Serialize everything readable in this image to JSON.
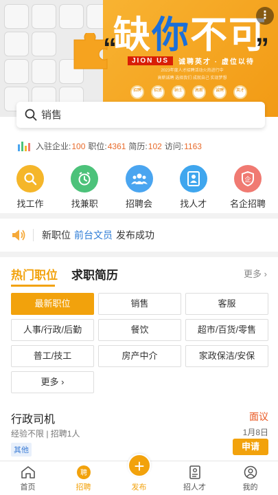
{
  "banner": {
    "title_left": "缺",
    "title_mid": "你",
    "title_right": "不可",
    "jion_tag": "JION US",
    "slogan": "诚聘英才 · 虚位以待",
    "line1": "2023年度人才招聘活动火热进行中",
    "line2": "高薪诚聘  选择我们  成就自己  实现梦想",
    "circles": [
      "招聘",
      "招贤",
      "纳士",
      "高薪",
      "诚聘",
      "英才"
    ],
    "more_icon": "more-dots-icon"
  },
  "search": {
    "placeholder": "销售"
  },
  "stats": {
    "companies_label": "入驻企业:",
    "companies": "100",
    "jobs_label": "职位:",
    "jobs": "4361",
    "resumes_label": "简历:",
    "resumes": "102",
    "visits_label": "访问:",
    "visits": "1163"
  },
  "quick": [
    {
      "label": "找工作",
      "icon": "search-icon",
      "color": "#f5b62a"
    },
    {
      "label": "找兼职",
      "icon": "clock-icon",
      "color": "#4cc27a"
    },
    {
      "label": "招聘会",
      "icon": "group-icon",
      "color": "#4aa5f0"
    },
    {
      "label": "找人才",
      "icon": "person-card-icon",
      "color": "#3fa6ee"
    },
    {
      "label": "名企招聘",
      "icon": "shield-icon",
      "color": "#f07a72"
    }
  ],
  "notice": {
    "prefix": "新职位",
    "job": "前台文员",
    "suffix": "发布成功",
    "icon": "speaker-icon"
  },
  "tabs": {
    "hot": "热门职位",
    "resume": "求职简历",
    "more": "更多 ›"
  },
  "categories": [
    "最新职位",
    "销售",
    "客服",
    "人事/行政/后勤",
    "餐饮",
    "超市/百货/零售",
    "普工/技工",
    "房产中介",
    "家政保洁/安保",
    "更多 ›"
  ],
  "job": {
    "title": "行政司机",
    "salary": "面议",
    "meta": "经验不限 | 招聘1人",
    "date": "1月8日",
    "tag": "其他",
    "apply": "申请"
  },
  "nav": {
    "home": "首页",
    "recruit": "招聘",
    "publish": "发布",
    "talent": "招人才",
    "mine": "我的"
  },
  "colors": {
    "accent": "#f2a20c",
    "link": "#2b7bd6",
    "number": "#e86a2a"
  }
}
